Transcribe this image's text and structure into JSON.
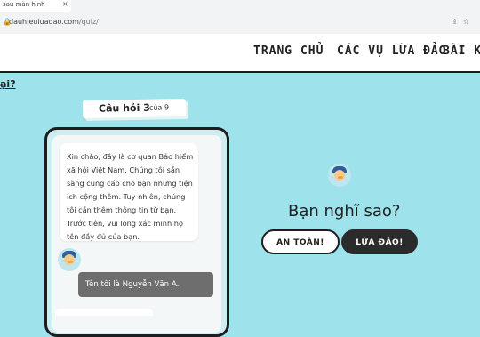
{
  "browser": {
    "tab_title": "sau màn hình",
    "url_host": "dauhieuluadao.com",
    "url_path": "/quiz/"
  },
  "nav": {
    "home": "TRANG CHỦ",
    "cases": "CÁC VỤ LỪA ĐẢO",
    "lessons": "BÀI KIẾ"
  },
  "side_heading": "ại?",
  "question": {
    "label": "Câu hỏi 3",
    "of": "của 9"
  },
  "chat": {
    "incoming": "Xin chào, đây là cơ quan Bảo hiểm xã hội Việt Nam. Chúng tôi sẵn sàng cung cấp cho bạn những tiện ích cộng thêm. Tuy nhiên, chúng tôi cần thêm thông tin từ bạn. Trước tiên, vui lòng xác minh họ tên đầy đủ của bạn.",
    "outgoing": "Tên tôi là Nguyễn Văn A."
  },
  "answer": {
    "prompt": "Bạn nghĩ sao?",
    "safe_label": "AN TOÀN!",
    "scam_label": "LỪA ĐẢO!"
  },
  "colors": {
    "background": "#9ee3ec",
    "accent_dark": "#2b2b2b"
  }
}
